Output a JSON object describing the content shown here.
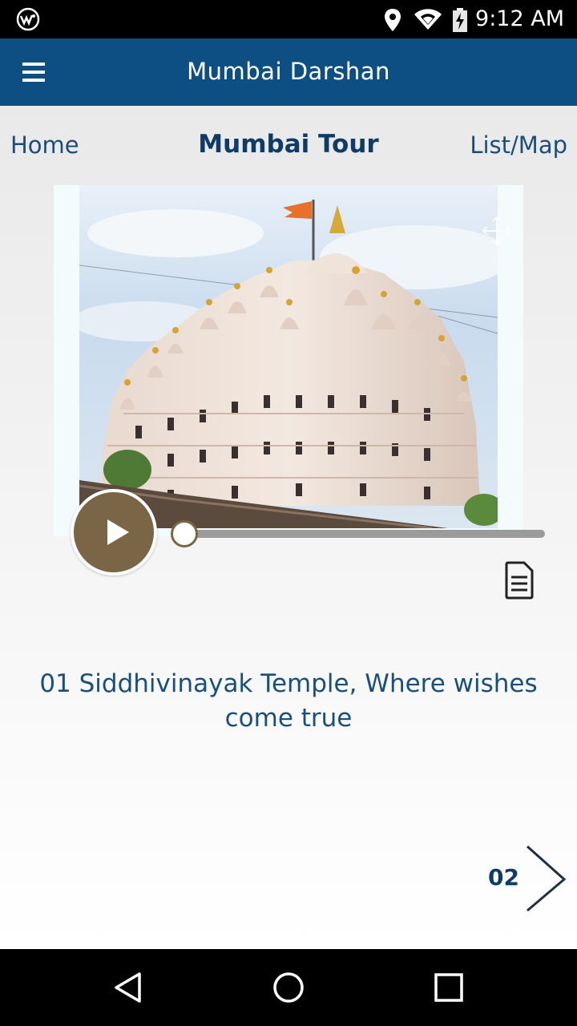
{
  "status_bar": {
    "time": "9:12 AM",
    "icons": [
      "app-logo-icon",
      "location-icon",
      "wifi-icon",
      "battery-charging-icon"
    ]
  },
  "app_bar": {
    "title": "Mumbai Darshan",
    "menu_icon": "hamburger-menu-icon"
  },
  "subnav": {
    "home": "Home",
    "title": "Mumbai Tour",
    "list_map": "List/Map"
  },
  "player": {
    "progress": 0.0,
    "play_icon": "play-icon",
    "transcript_icon": "document-icon",
    "expand_icon": "expand-arrows-icon",
    "accent_color": "#7a6647"
  },
  "stop": {
    "caption": "01 Siddhivinayak Temple, Where wishes come true"
  },
  "next": {
    "number": "02",
    "icon": "chevron-right-icon"
  },
  "nav_bar": {
    "icons": [
      "back-triangle-icon",
      "home-circle-icon",
      "recents-square-icon"
    ]
  },
  "colors": {
    "brand": "#0d4f83",
    "text_blue": "#1a4f7d"
  }
}
